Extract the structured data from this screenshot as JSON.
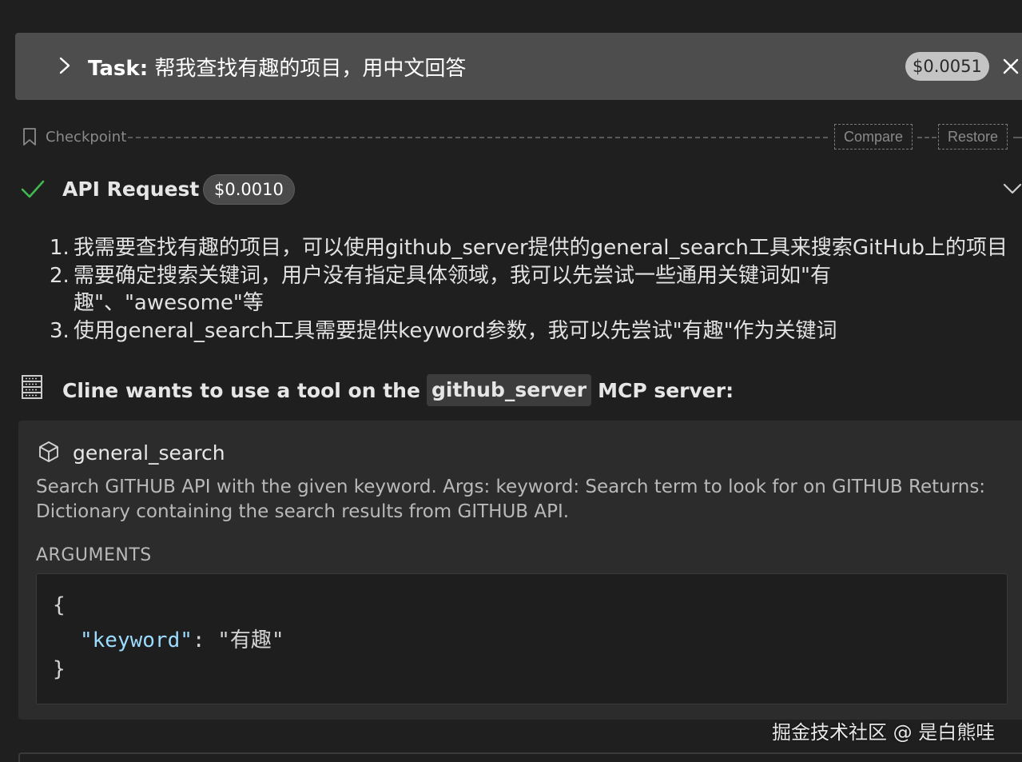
{
  "task": {
    "label": "Task:",
    "text": "帮我查找有趣的项目，用中文回答",
    "cost": "$0.0051"
  },
  "checkpoint": {
    "label": "Checkpoint",
    "compare_label": "Compare",
    "restore_label": "Restore"
  },
  "api_request": {
    "title": "API Request",
    "cost": "$0.0010"
  },
  "reasoning": [
    {
      "num": "1.",
      "text": "我需要查找有趣的项目，可以使用github_server提供的general_search工具来搜索GitHub上的项目"
    },
    {
      "num": "2.",
      "text": "需要确定搜索关键词，用户没有指定具体领域，我可以先尝试一些通用关键词如\"有趣\"、\"awesome\"等"
    },
    {
      "num": "3.",
      "text": "使用general_search工具需要提供keyword参数，我可以先尝试\"有趣\"作为关键词"
    }
  ],
  "mcp": {
    "prefix": "Cline wants to use a tool on the",
    "server": "github_server",
    "suffix": "MCP server:"
  },
  "tool": {
    "name": "general_search",
    "description": "Search GITHUB API with the given keyword. Args: keyword: Search term to look for on GITHUB Returns: Dictionary containing the search results from GITHUB API.",
    "arguments_label": "ARGUMENTS",
    "code": {
      "open": "{",
      "key": "\"keyword\"",
      "sep": ": ",
      "value": "\"有趣\"",
      "close": "}"
    }
  },
  "watermark": "掘金技术社区 @ 是白熊哇",
  "colors": {
    "background": "#1f1f1f",
    "task_bar": "#4d4d4d",
    "card": "#2c2c2c",
    "json_key": "#9cdcfe",
    "check": "#3fb950"
  }
}
